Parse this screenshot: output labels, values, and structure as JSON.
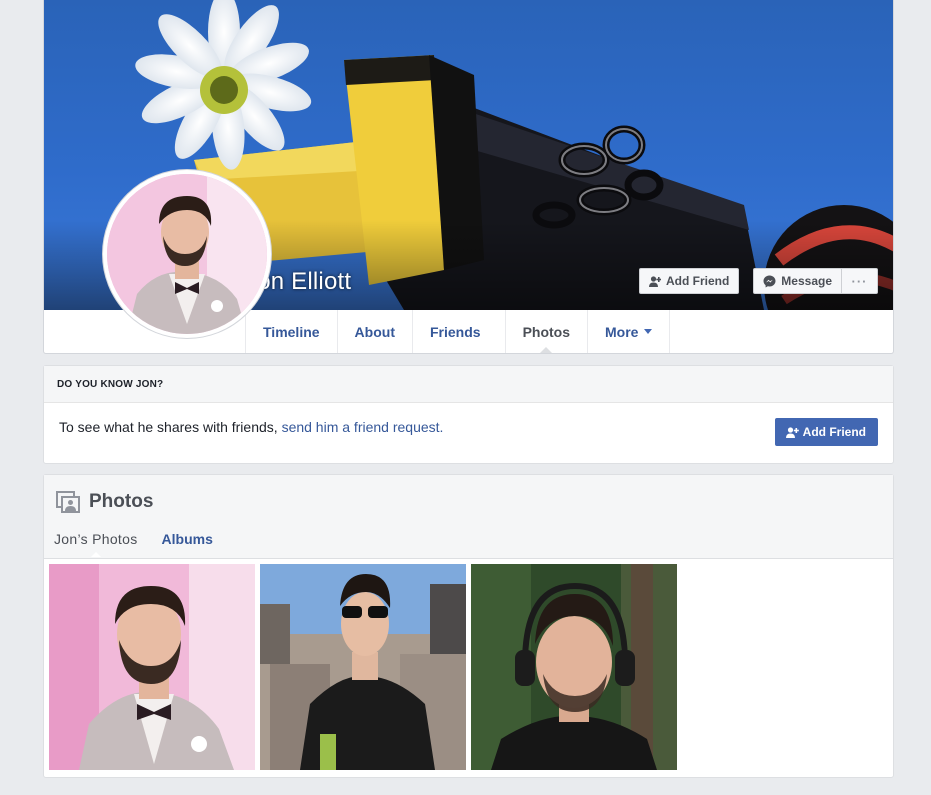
{
  "profile": {
    "name": "Jon Elliott"
  },
  "cover_actions": {
    "add_friend_label": "Add Friend",
    "message_label": "Message",
    "more_label": "···"
  },
  "nav": {
    "tabs": [
      {
        "label": "Timeline"
      },
      {
        "label": "About"
      },
      {
        "label": "Friends"
      },
      {
        "label": "Photos"
      },
      {
        "label": "More"
      }
    ],
    "active": "Photos"
  },
  "know_card": {
    "heading": "DO YOU KNOW JON?",
    "text": "To see what he shares with friends, ",
    "link_text": "send him a friend request.",
    "button_label": "Add Friend"
  },
  "photos": {
    "title": "Photos",
    "tabs": [
      {
        "label": "Jon’s Photos"
      },
      {
        "label": "Albums"
      }
    ],
    "items": [
      {
        "icon": "photo-wedding-portrait"
      },
      {
        "icon": "photo-rooftop-sunglasses"
      },
      {
        "icon": "photo-headphones-selfie"
      }
    ]
  },
  "colors": {
    "brand_blue": "#4267b2",
    "link_blue": "#365899",
    "page_bg": "#e9ebee"
  }
}
